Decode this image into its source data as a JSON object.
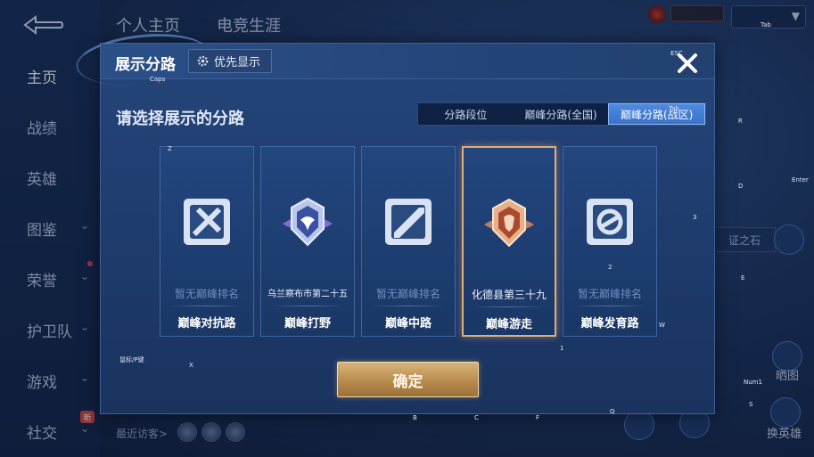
{
  "background": {
    "top_tabs": [
      "个人主页",
      "电竞生涯"
    ],
    "nav": [
      {
        "label": "主页",
        "has_chevron": false
      },
      {
        "label": "战绩",
        "has_chevron": false
      },
      {
        "label": "英雄",
        "has_chevron": false
      },
      {
        "label": "图鉴",
        "has_chevron": true
      },
      {
        "label": "荣誉",
        "has_chevron": true
      },
      {
        "label": "护卫队",
        "has_chevron": true
      },
      {
        "label": "游戏",
        "has_chevron": true
      },
      {
        "label": "社交",
        "has_chevron": true
      }
    ],
    "new_badge": "新",
    "recent_visitors": "最近访客>",
    "right_labels": [
      "晒图",
      "换英雄"
    ],
    "right_strip": "证之石"
  },
  "modal": {
    "title": "展示分路",
    "priority_button": "优先显示",
    "subtitle": "请选择展示的分路",
    "tabs": [
      {
        "label": "分路段位",
        "active": false
      },
      {
        "label": "巅峰分路(全国)",
        "active": false
      },
      {
        "label": "巅峰分路(战区)",
        "active": true
      }
    ],
    "cards": [
      {
        "name": "巅峰对抗路",
        "rank": "暂无巅峰排名",
        "has_rank": false,
        "icon": "clash-lane-icon"
      },
      {
        "name": "巅峰打野",
        "rank": "乌兰察布市第二十五",
        "has_rank": true,
        "icon": "jungle-emblem-icon"
      },
      {
        "name": "巅峰中路",
        "rank": "暂无巅峰排名",
        "has_rank": false,
        "icon": "mid-lane-icon"
      },
      {
        "name": "巅峰游走",
        "rank": "化德县第三十九",
        "has_rank": true,
        "icon": "roam-emblem-icon",
        "selected": true
      },
      {
        "name": "巅峰发育路",
        "rank": "暂无巅峰排名",
        "has_rank": false,
        "icon": "farm-lane-icon"
      }
    ],
    "confirm": "确定"
  },
  "key_hints": [
    "Caps",
    "Z",
    "X",
    "Tab",
    "R",
    "Enter",
    "D",
    "E",
    "Q",
    "W",
    "1",
    "2",
    "3",
    "B",
    "C",
    "F",
    "Num1",
    "S",
    "ESC",
    "Tab",
    "鼠标/P键"
  ],
  "colors": {
    "modal_bg": "#25457a",
    "selected_border": "#e2ac76",
    "active_tab": "#3a72c8",
    "confirm_gold": "#c99a5e"
  }
}
